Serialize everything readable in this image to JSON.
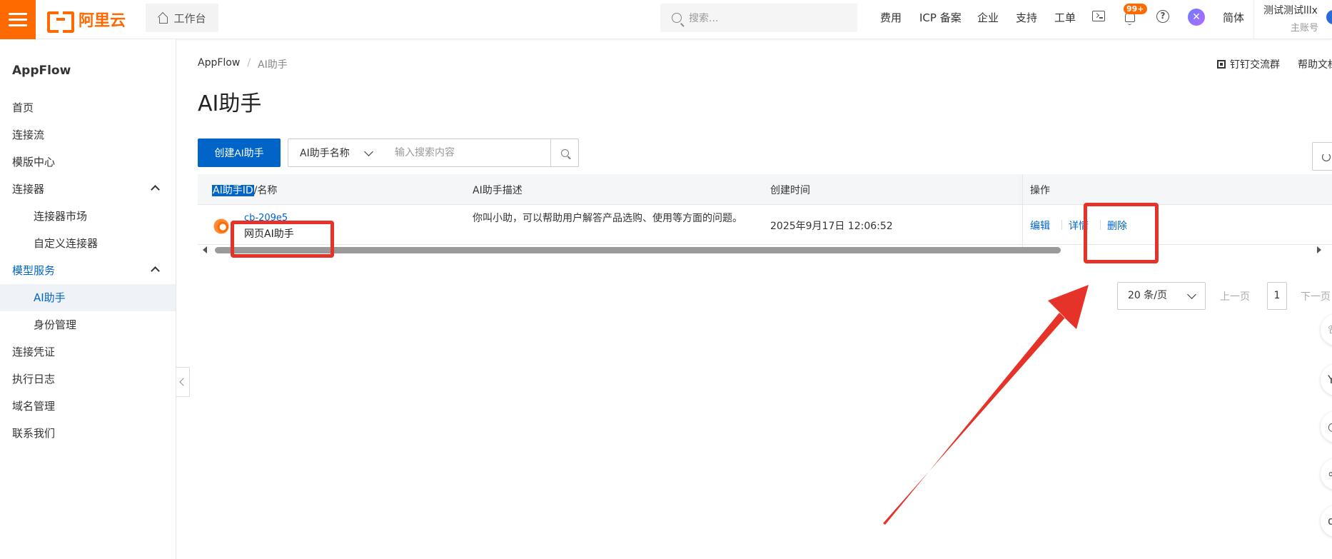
{
  "topbar": {
    "logo_text": "阿里云",
    "workbench_label": "工作台",
    "search_placeholder": "搜索...",
    "links": [
      "费用",
      "ICP 备案",
      "企业",
      "支持",
      "工单"
    ],
    "notification_badge": "99+",
    "language": "简体",
    "user_name": "测试测试lllx",
    "user_role": "主账号",
    "brand_color": "#ff6a00"
  },
  "sidebar": {
    "title": "AppFlow",
    "items": [
      {
        "label": "首页"
      },
      {
        "label": "连接流"
      },
      {
        "label": "模版中心"
      },
      {
        "label": "连接器"
      },
      {
        "label": "连接器市场"
      },
      {
        "label": "自定义连接器"
      },
      {
        "label": "模型服务"
      },
      {
        "label": "AI助手"
      },
      {
        "label": "身份管理"
      },
      {
        "label": "连接凭证"
      },
      {
        "label": "执行日志"
      },
      {
        "label": "域名管理"
      },
      {
        "label": "联系我们"
      }
    ],
    "active_item": "AI助手"
  },
  "main": {
    "breadcrumb": [
      "AppFlow",
      "AI助手"
    ],
    "links": {
      "dingtalk_group": "钉钉交流群",
      "help_doc": "帮助文档"
    },
    "title": "AI助手",
    "toolbar": {
      "create_label": "创建AI助手",
      "filter_field": "AI助手名称",
      "search_placeholder": "输入搜索内容"
    },
    "table": {
      "columns": {
        "id_name_highlight": "AI助手ID",
        "id_name_rest": "/名称",
        "description": "AI助手描述",
        "created": "创建时间",
        "actions": "操作"
      },
      "rows": [
        {
          "id": "cb-209e5",
          "name": "网页AI助手",
          "description": "你叫小助，可以帮助用户解答产品选购、使用等方面的问题。",
          "created": "2025年9月17日 12:06:52",
          "actions": {
            "edit": "编辑",
            "detail": "详情",
            "delete": "删除"
          }
        }
      ]
    },
    "pagination": {
      "page_size": "20 条/页",
      "prev": "上一页",
      "current_page": "1",
      "next": "下一页"
    },
    "accent_color": "#0064c8",
    "annotation_color": "#e5332a"
  }
}
